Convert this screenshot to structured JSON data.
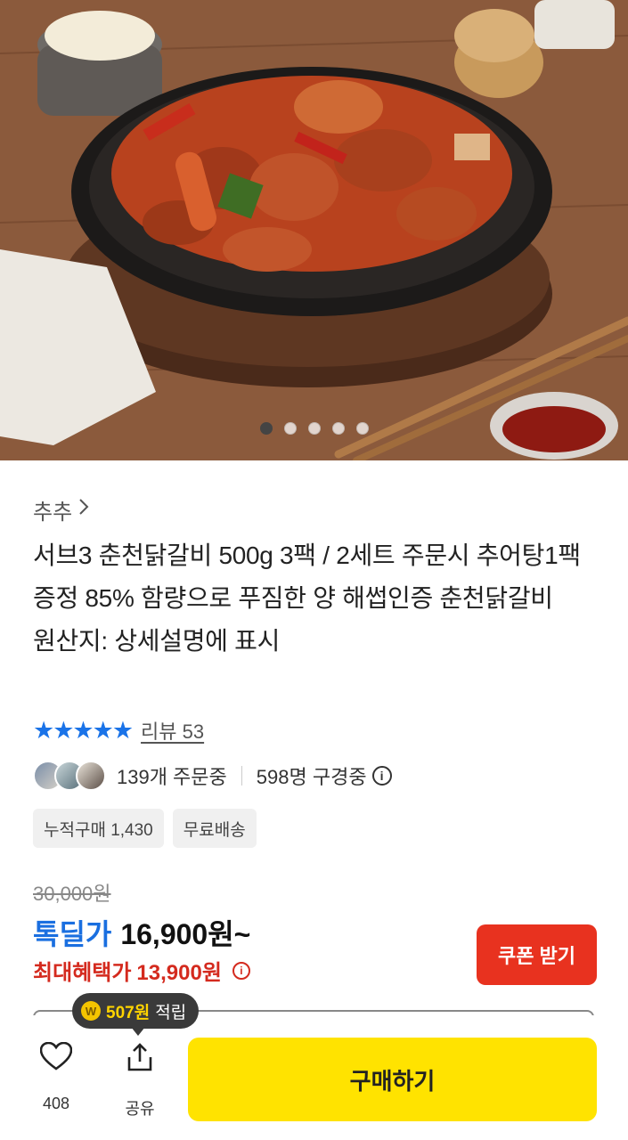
{
  "hero": {
    "image_alt": "",
    "carousel_total": 5,
    "carousel_active": 1
  },
  "seller": {
    "name": "추추",
    "chevron": "chevron-right-icon"
  },
  "product": {
    "title": "서브3 춘천닭갈비 500g 3팩 / 2세트 주문시 추어탕1팩 증정 85% 함량으로 푸짐한 양 해썹인증 춘천닭갈비",
    "origin": "원산지: 상세설명에 표시"
  },
  "rating": {
    "stars": "★★★★★",
    "review_text": "리뷰 53",
    "rating_value": 5
  },
  "social": {
    "orders": "139개 주문중",
    "viewers": "598명 구경중",
    "info_icon": "ⓘ"
  },
  "chips": [
    "누적구매 1,430",
    "무료배송"
  ],
  "price": {
    "original": "30,000원",
    "deal_label": "톡딜가",
    "deal_price": "16,900원~",
    "max_label": "최대혜택가",
    "max_price": "13,900원"
  },
  "coupon": {
    "label": "쿠폰 받기"
  },
  "points_tooltip": {
    "coin": "W",
    "amount": "507원",
    "suffix": "적립"
  },
  "bottom": {
    "like_count": "408",
    "share_label": "공유",
    "buy_label": "구매하기"
  },
  "colors": {
    "accent_blue": "#1a6fe0",
    "accent_red": "#d42a1e",
    "coupon_red": "#e8321f",
    "buy_yellow": "#ffe300"
  }
}
